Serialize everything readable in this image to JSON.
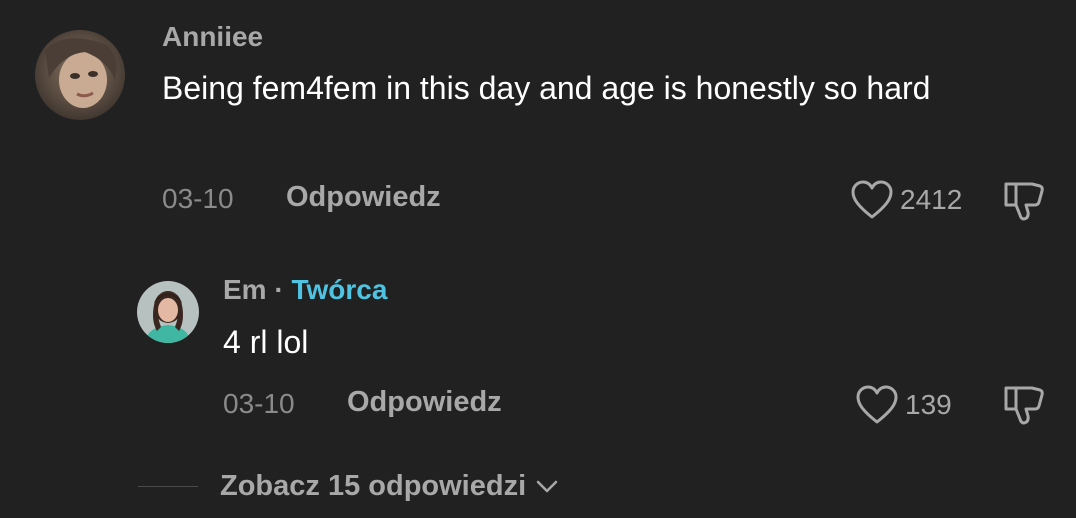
{
  "comment": {
    "username": "Anniiee",
    "text": "Being fem4fem in this day and age is honestly so hard",
    "date": "03-10",
    "reply_label": "Odpowiedz",
    "likes": "2412"
  },
  "reply": {
    "username": "Em",
    "separator": "·",
    "creator_label": "Twórca",
    "text": "4 rl lol",
    "date": "03-10",
    "reply_label": "Odpowiedz",
    "likes": "139"
  },
  "view_replies_label": "Zobacz 15 odpowiedzi",
  "colors": {
    "background": "#212121",
    "creator_accent": "#4fc4e2",
    "muted_text": "#a8a8a8"
  },
  "icons": {
    "like": "heart-outline-icon",
    "dislike": "thumbs-down-outline-icon",
    "expand": "chevron-down-icon"
  }
}
